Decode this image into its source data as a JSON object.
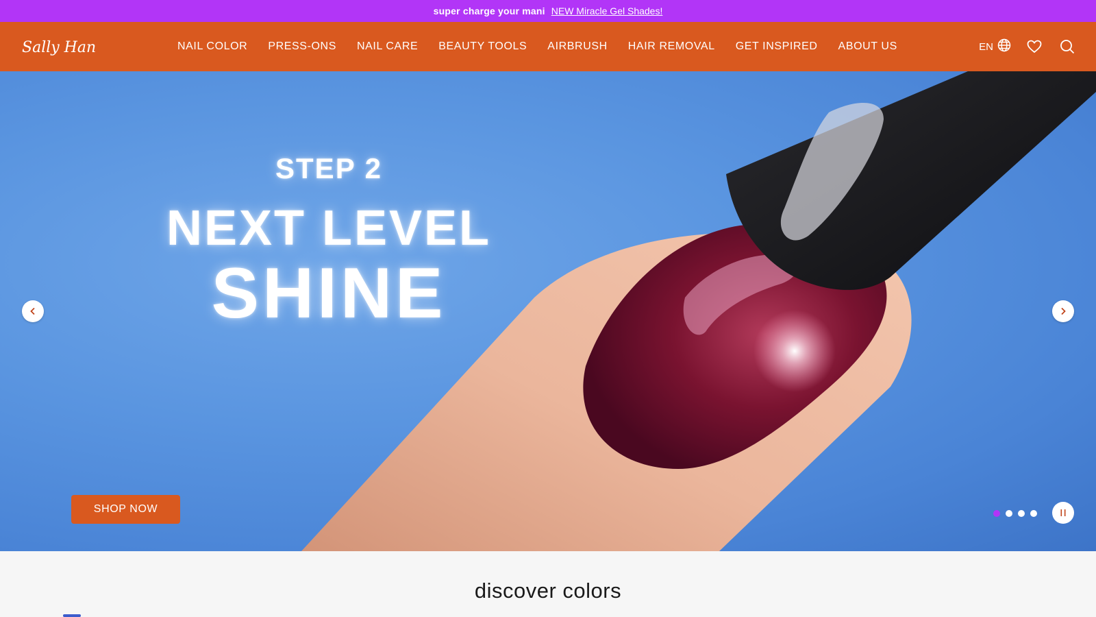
{
  "promo": {
    "lead": "super charge your mani",
    "link": "NEW Miracle Gel Shades!"
  },
  "brand": {
    "logo_text": "Sally Hansen."
  },
  "nav": {
    "items": [
      {
        "label": "NAIL COLOR"
      },
      {
        "label": "PRESS-ONS"
      },
      {
        "label": "NAIL CARE"
      },
      {
        "label": "BEAUTY TOOLS"
      },
      {
        "label": "AIRBRUSH"
      },
      {
        "label": "HAIR REMOVAL"
      },
      {
        "label": "GET INSPIRED"
      },
      {
        "label": "ABOUT US"
      }
    ]
  },
  "utils": {
    "lang": "EN",
    "icons": [
      "globe-icon",
      "heart-icon",
      "search-icon"
    ]
  },
  "hero": {
    "step": "STEP 2",
    "headline": "NEXT LEVEL",
    "subheadline": "SHINE",
    "cta": "SHOP NOW",
    "slide_count": 4,
    "active_slide": 1
  },
  "discover": {
    "title": "discover colors"
  },
  "colors": {
    "promo_bg": "#b235f7",
    "header_bg": "#d9591f",
    "hero_bg": "#5a95e0",
    "active_dot": "#b235f7"
  }
}
